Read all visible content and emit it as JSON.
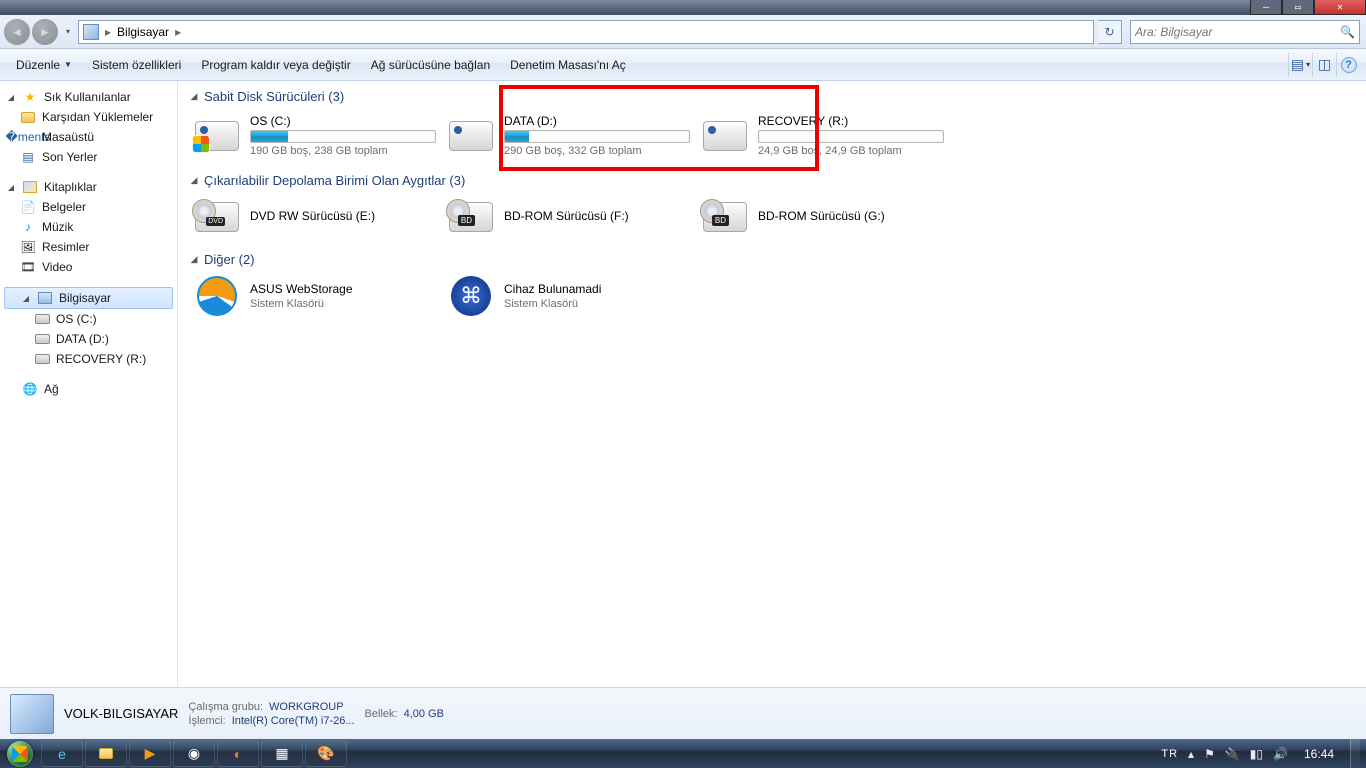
{
  "window": {
    "location": "Bilgisayar",
    "search_placeholder": "Ara: Bilgisayar"
  },
  "commands": {
    "organize": "Düzenle",
    "properties": "Sistem özellikleri",
    "uninstall": "Program kaldır veya değiştir",
    "map_drive": "Ağ sürücüsüne bağlan",
    "control_panel": "Denetim Masası'nı Aç"
  },
  "sidebar": {
    "favorites": {
      "label": "Sık Kullanılanlar",
      "items": [
        "Karşıdan Yüklemeler",
        "Masaüstü",
        "Son Yerler"
      ]
    },
    "libraries": {
      "label": "Kitaplıklar",
      "items": [
        "Belgeler",
        "Müzik",
        "Resimler",
        "Video"
      ]
    },
    "computer": {
      "label": "Bilgisayar",
      "items": [
        "OS (C:)",
        "DATA (D:)",
        "RECOVERY (R:)"
      ]
    },
    "network": {
      "label": "Ağ"
    }
  },
  "categories": {
    "hdd": {
      "title": "Sabit Disk Sürücüleri (3)",
      "drives": [
        {
          "name": "OS (C:)",
          "sub": "190 GB boş, 238 GB toplam",
          "fill_pct": 20
        },
        {
          "name": "DATA (D:)",
          "sub": "290 GB boş, 332 GB toplam",
          "fill_pct": 13
        },
        {
          "name": "RECOVERY (R:)",
          "sub": "24,9 GB boş, 24,9 GB toplam",
          "fill_pct": 0
        }
      ]
    },
    "removable": {
      "title": "Çıkarılabilir Depolama Birimi Olan Aygıtlar (3)",
      "drives": [
        {
          "name": "DVD RW Sürücüsü (E:)"
        },
        {
          "name": "BD-ROM Sürücüsü (F:)"
        },
        {
          "name": "BD-ROM Sürücüsü (G:)"
        }
      ]
    },
    "other": {
      "title": "Diğer (2)",
      "items": [
        {
          "name": "ASUS WebStorage",
          "sub": "Sistem Klasörü"
        },
        {
          "name": "Cihaz Bulunamadi",
          "sub": "Sistem Klasörü"
        }
      ]
    }
  },
  "details": {
    "computer_name": "VOLK-BILGISAYAR",
    "workgroup_label": "Çalışma grubu:",
    "workgroup": "WORKGROUP",
    "cpu_label": "İşlemci:",
    "cpu": "Intel(R) Core(TM) i7-26...",
    "memory_label": "Bellek:",
    "memory": "4,00 GB"
  },
  "taskbar": {
    "lang": "TR",
    "time": "16:44"
  }
}
